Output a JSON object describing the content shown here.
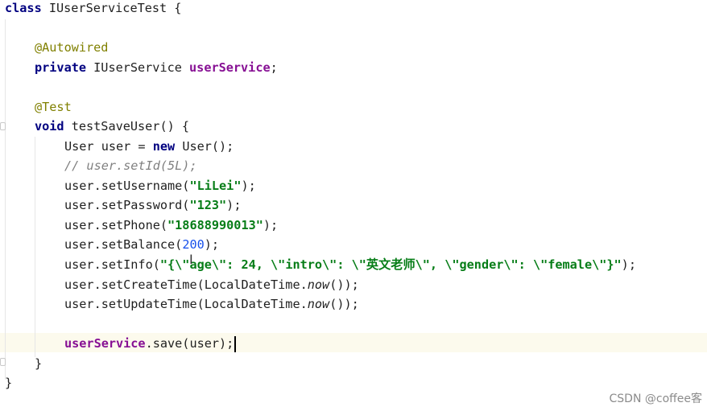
{
  "code": {
    "line_1": {
      "keyword": "class",
      "rest": " IUserServiceTest {"
    },
    "line_2": {
      "annotation": "@Autowired"
    },
    "line_3": {
      "keyword": "private",
      "type": " IUserService ",
      "field": "userService",
      "semicolon": ";"
    },
    "line_4": {
      "annotation": "@Test"
    },
    "line_5": {
      "keyword": "void",
      "rest": " testSaveUser() {"
    },
    "line_6": {
      "a": "User user = ",
      "keyword": "new",
      "b": " User();"
    },
    "line_7": {
      "comment": "// user.setId(5L);"
    },
    "line_8": {
      "a": "user.setUsername(",
      "str": "\"LiLei\"",
      "b": ");"
    },
    "line_9": {
      "a": "user.setPassword(",
      "str": "\"123\"",
      "b": ");"
    },
    "line_10": {
      "a": "user.setPhone(",
      "str": "\"18688990013\"",
      "b": ");"
    },
    "line_11": {
      "a": "user.setBalance(",
      "num": "200",
      "b": ");"
    },
    "line_12": {
      "a": "user.setInfo(",
      "str": "\"{\\\"age\\\": 24, \\\"intro\\\": \\\"英文老师\\\", \\\"gender\\\": \\\"female\\\"}\"",
      "b": ");"
    },
    "line_13": {
      "a": "user.setCreateTime(LocalDateTime.",
      "italic": "now",
      "b": "());"
    },
    "line_14": {
      "a": "user.setUpdateTime(LocalDateTime.",
      "italic": "now",
      "b": "());"
    },
    "line_15": {
      "field": "userService",
      "rest": ".save(user);"
    },
    "line_16": {
      "brace": "}"
    },
    "line_17": {
      "brace": "}"
    }
  },
  "watermark": {
    "text": "CSDN @coffee客"
  },
  "colors": {
    "keyword": "#000080",
    "annotation": "#808000",
    "comment": "#808080",
    "string": "#067d17",
    "number": "#1750eb",
    "field": "#871094",
    "caret_line": "#fcfaed"
  }
}
